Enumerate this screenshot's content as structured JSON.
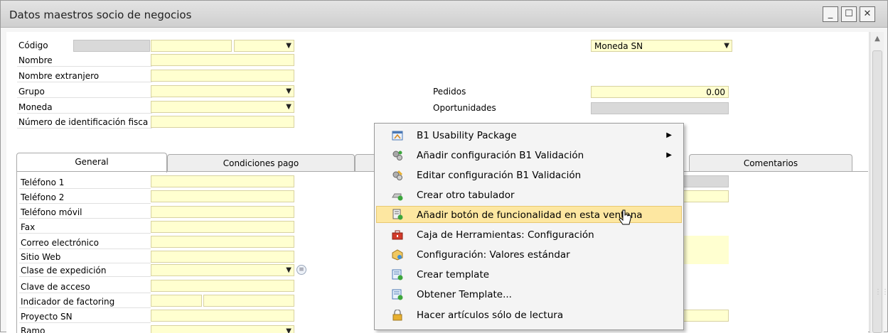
{
  "window": {
    "title": "Datos maestros socio de negocios",
    "minimize": "_",
    "maximize": "☐",
    "close": "✕"
  },
  "header_fields": {
    "codigo": "Código",
    "nombre": "Nombre",
    "nombre_extranjero": "Nombre extranjero",
    "grupo": "Grupo",
    "moneda": "Moneda",
    "nif": "Número de identificación fisca",
    "moneda_sn_value": "Moneda SN",
    "pedidos": "Pedidos",
    "pedidos_value": "0.00",
    "oportunidades": "Oportunidades"
  },
  "tabs": {
    "general": "General",
    "condiciones_pago": "Condiciones pago",
    "comentarios": "Comentarios"
  },
  "general_fields": {
    "telefono1": "Teléfono 1",
    "telefono2": "Teléfono 2",
    "telefono_movil": "Teléfono móvil",
    "fax": "Fax",
    "correo": "Correo electrónico",
    "sitio_web": "Sitio Web",
    "clase_expedicion": "Clase de expedición",
    "clave_acceso": "Clave de acceso",
    "indicador_factoring": "Indicador de factoring",
    "proyecto_sn": "Proyecto SN",
    "ramo": "Ramo"
  },
  "context_menu": {
    "items": [
      {
        "label": "B1 Usability Package",
        "icon": "usability-package-icon",
        "submenu": true
      },
      {
        "label": "Añadir configuración B1 Validación",
        "icon": "gears-add-icon",
        "submenu": true
      },
      {
        "label": "Editar configuración B1 Validación",
        "icon": "gears-edit-icon",
        "submenu": false
      },
      {
        "label": "Crear otro tabulador",
        "icon": "tab-add-icon",
        "submenu": false
      },
      {
        "label": "Añadir botón de funcionalidad en esta ventana",
        "icon": "add-button-icon",
        "submenu": false,
        "highlighted": true
      },
      {
        "label": "Caja de Herramientas: Configuración",
        "icon": "toolbox-icon",
        "submenu": false
      },
      {
        "label": "Configuración: Valores estándar",
        "icon": "box-defaults-icon",
        "submenu": false
      },
      {
        "label": "Crear template",
        "icon": "template-create-icon",
        "submenu": false
      },
      {
        "label": "Obtener Template...",
        "icon": "template-get-icon",
        "submenu": false
      },
      {
        "label": "Hacer artículos sólo de lectura",
        "icon": "lock-icon",
        "submenu": false
      }
    ],
    "submenu_arrow": "▶"
  },
  "colors": {
    "field_yellow": "#ffffd0",
    "highlight": "#fde7a1"
  }
}
